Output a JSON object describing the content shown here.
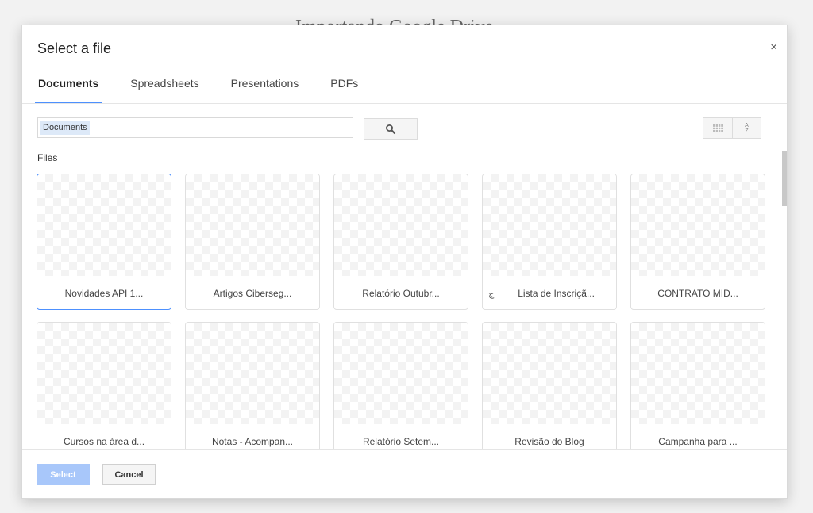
{
  "background": {
    "title": "Importando Google Drive"
  },
  "dialog": {
    "title": "Select a file",
    "close_label": "×"
  },
  "tabs": [
    {
      "label": "Documents",
      "active": true
    },
    {
      "label": "Spreadsheets",
      "active": false
    },
    {
      "label": "Presentations",
      "active": false
    },
    {
      "label": "PDFs",
      "active": false
    }
  ],
  "search": {
    "value": "Documents",
    "button_icon": "search-icon"
  },
  "view_buttons": {
    "grid_icon": "grid-view-icon",
    "sort_icon": "sort-az-icon",
    "sort_text": "A Z"
  },
  "files_label": "Files",
  "files": [
    {
      "name": "Novidades API 1...",
      "selected": true
    },
    {
      "name": "Artigos Ciberseg...",
      "selected": false
    },
    {
      "name": "Relatório Outubr...",
      "selected": false
    },
    {
      "name": "Lista de Inscriçã...",
      "selected": false,
      "icon": "ج"
    },
    {
      "name": "CONTRATO MID...",
      "selected": false
    },
    {
      "name": "Cursos na área d...",
      "selected": false
    },
    {
      "name": "Notas - Acompan...",
      "selected": false
    },
    {
      "name": "Relatório Setem...",
      "selected": false
    },
    {
      "name": "Revisão do Blog",
      "selected": false
    },
    {
      "name": "Campanha para ...",
      "selected": false
    }
  ],
  "footer": {
    "select_label": "Select",
    "cancel_label": "Cancel"
  },
  "colors": {
    "accent": "#4d90fe",
    "select_disabled": "#a8c7fa"
  }
}
